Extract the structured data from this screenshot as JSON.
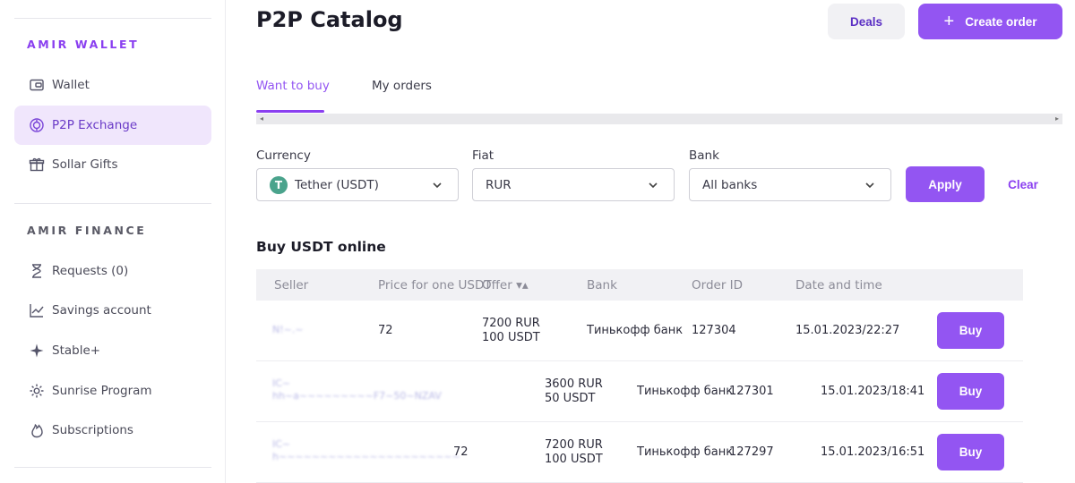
{
  "sidebar": {
    "section_wallet": "AMIR WALLET",
    "section_finance": "AMIR FINANCE",
    "items": [
      {
        "label": "Wallet",
        "icon": "wallet-icon"
      },
      {
        "label": "P2P Exchange",
        "icon": "exchange-icon"
      },
      {
        "label": "Sollar Gifts",
        "icon": "gift-icon"
      },
      {
        "label": "Requests (0)",
        "icon": "hourglass-icon"
      },
      {
        "label": "Savings account",
        "icon": "chart-icon"
      },
      {
        "label": "Stable+",
        "icon": "sparkle-icon"
      },
      {
        "label": "Sunrise Program",
        "icon": "gear-icon"
      },
      {
        "label": "Subscriptions",
        "icon": "flame-icon"
      }
    ]
  },
  "header": {
    "title": "P2P Catalog",
    "deals_label": "Deals",
    "create_label": "Create order"
  },
  "tabs": [
    {
      "label": "Want to buy"
    },
    {
      "label": "My orders"
    }
  ],
  "filters": {
    "currency_label": "Currency",
    "currency_value": "Tether (USDT)",
    "currency_icon": "T",
    "fiat_label": "Fiat",
    "fiat_value": "RUR",
    "bank_label": "Bank",
    "bank_value": "All banks",
    "apply_label": "Apply",
    "clear_label": "Clear"
  },
  "table": {
    "title": "Buy USDT online",
    "columns": [
      "Seller",
      "Price for one USDT",
      "Offer ▾▴",
      "Bank",
      "Order ID",
      "Date and time"
    ],
    "rows": [
      {
        "price": "72",
        "offer_rur": "7200 RUR",
        "offer_usdt": "100 USDT",
        "bank": "Тинькофф банк",
        "order_id": "127304",
        "datetime": "15.01.2023/22:27",
        "buy": "Buy"
      },
      {
        "price": "",
        "offer_rur": "3600 RUR",
        "offer_usdt": "50 USDT",
        "bank": "Тинькофф банк",
        "order_id": "127301",
        "datetime": "15.01.2023/18:41",
        "buy": "Buy"
      },
      {
        "price": "72",
        "offer_rur": "7200 RUR",
        "offer_usdt": "100 USDT",
        "bank": "Тинькофф банк",
        "order_id": "127297",
        "datetime": "15.01.2023/16:51",
        "buy": "Buy"
      }
    ]
  },
  "colors": {
    "accent": "#9355f2",
    "active_bg": "#f0e6fc"
  }
}
